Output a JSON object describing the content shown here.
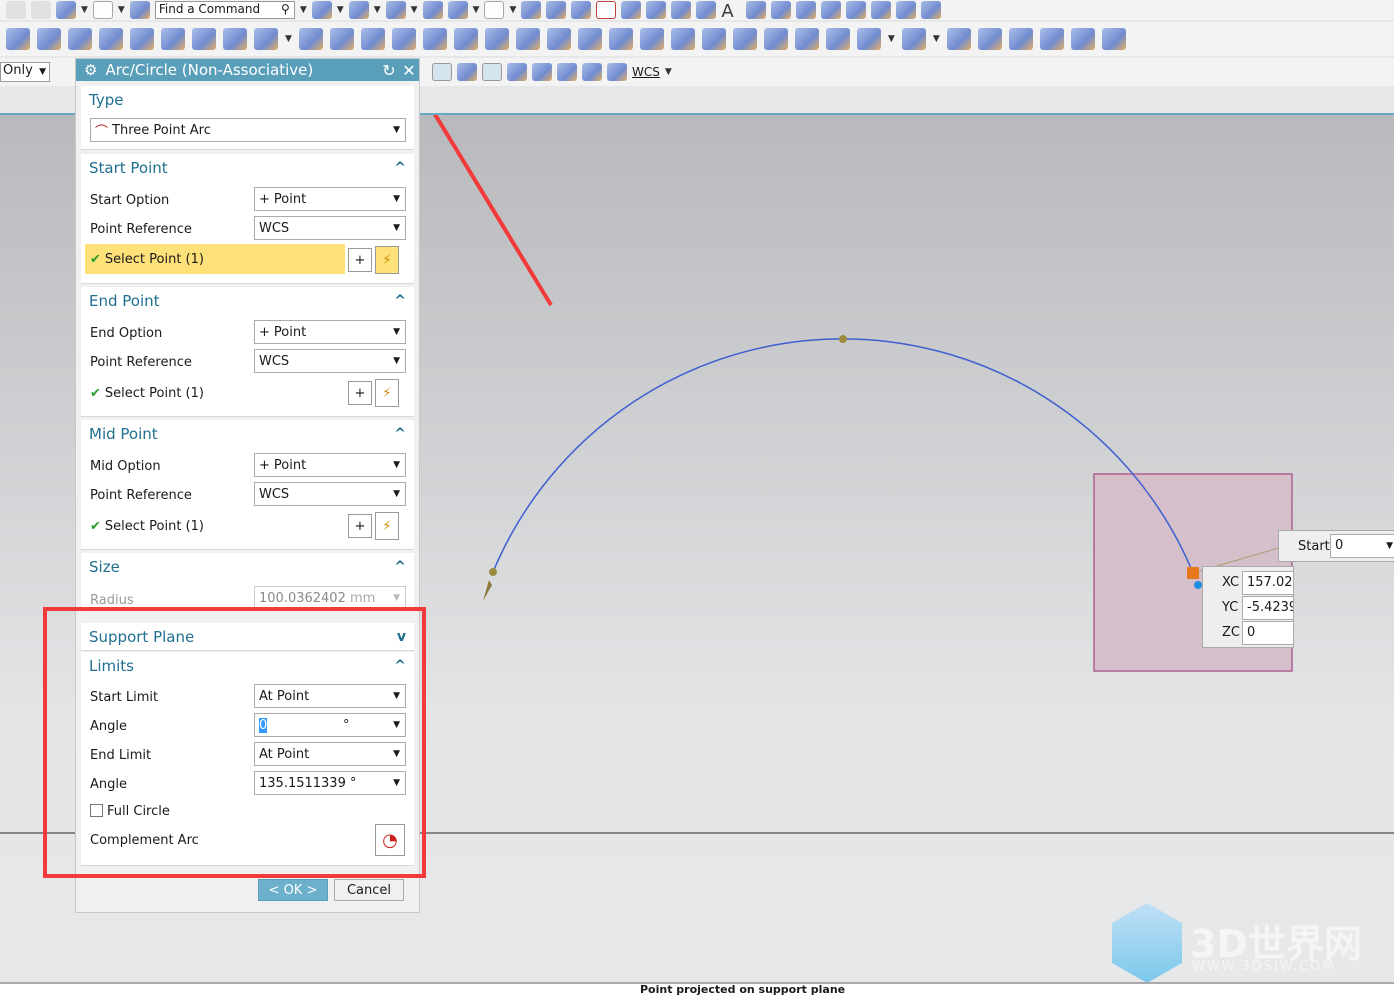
{
  "toolbar": {
    "find_command_placeholder": "Find a Command",
    "filter_value": "Only",
    "csys_label": "WCS"
  },
  "dialog": {
    "title": "Arc/Circle (Non-Associative)",
    "type": {
      "header": "Type",
      "value": "Three Point Arc"
    },
    "start_point": {
      "header": "Start Point",
      "option_label": "Start Option",
      "option_value": "Point",
      "ref_label": "Point Reference",
      "ref_value": "WCS",
      "select_label": "Select Point (1)"
    },
    "end_point": {
      "header": "End Point",
      "option_label": "End Option",
      "option_value": "Point",
      "ref_label": "Point Reference",
      "ref_value": "WCS",
      "select_label": "Select Point (1)"
    },
    "mid_point": {
      "header": "Mid Point",
      "option_label": "Mid Option",
      "option_value": "Point",
      "ref_label": "Point Reference",
      "ref_value": "WCS",
      "select_label": "Select Point (1)"
    },
    "size": {
      "header": "Size",
      "radius_label": "Radius",
      "radius_value": "100.0362402",
      "radius_unit": "mm"
    },
    "support_plane": {
      "header": "Support Plane"
    },
    "limits": {
      "header": "Limits",
      "start_limit_label": "Start Limit",
      "start_limit_value": "At Point",
      "start_angle_label": "Angle",
      "start_angle_value": "0",
      "degree": "°",
      "end_limit_label": "End Limit",
      "end_limit_value": "At Point",
      "end_angle_label": "Angle",
      "end_angle_value": "135.1511339",
      "full_circle_label": "Full Circle",
      "full_circle_checked": false,
      "complement_label": "Complement Arc"
    },
    "ok_label": "< OK >",
    "cancel_label": "Cancel"
  },
  "onscreen": {
    "start_label": "Start",
    "start_value": "0",
    "xc_label": "XC",
    "xc_value": "157.02",
    "yc_label": "YC",
    "yc_value": "-5.4239",
    "zc_label": "ZC",
    "zc_value": "0"
  },
  "status": {
    "message": "Point projected on support plane"
  },
  "watermark": {
    "text": "3D世界网",
    "url_text": "WWW.3DSJW.COM"
  },
  "colors": {
    "accent": "#5a9fb9",
    "highlight": "#ffe17a",
    "arc": "#3d5fd0",
    "annotation": "#f23a3a"
  }
}
